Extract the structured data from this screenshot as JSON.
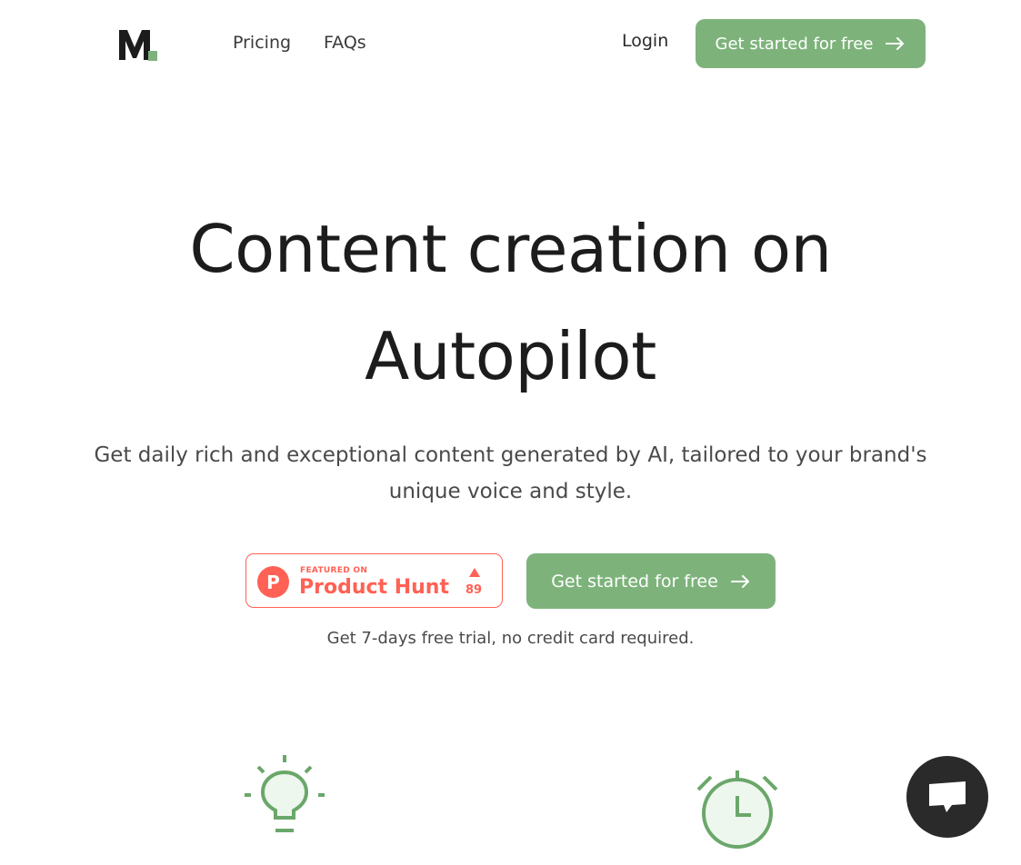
{
  "header": {
    "nav": [
      {
        "label": "Pricing"
      },
      {
        "label": "FAQs"
      }
    ],
    "login_label": "Login",
    "cta_label": "Get started for free"
  },
  "hero": {
    "title_line1": "Content creation on",
    "title_line2": "Autopilot",
    "subtitle": "Get daily rich and exceptional content generated by AI, tailored to your brand's unique voice and style.",
    "product_hunt": {
      "featured_on": "FEATURED ON",
      "name": "Product Hunt",
      "upvotes": "89",
      "logo_letter": "P"
    },
    "cta_label": "Get started for free",
    "trial_note": "Get 7-days free trial, no credit card required."
  },
  "colors": {
    "accent": "#7db37b",
    "product_hunt": "#ff6154",
    "text": "#1c1c1c"
  },
  "icons": [
    "logo-m",
    "arrow-right-icon",
    "lightbulb-icon",
    "alarm-clock-icon",
    "chat-icon"
  ]
}
